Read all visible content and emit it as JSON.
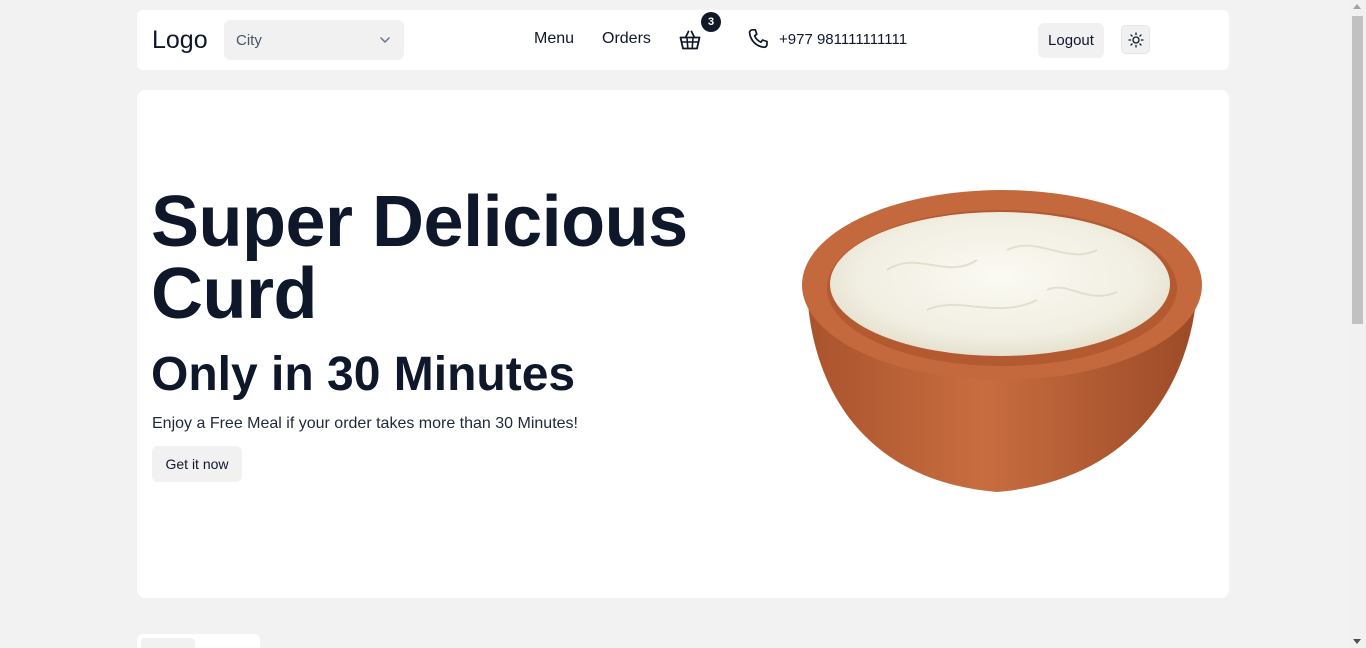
{
  "header": {
    "logo": "Logo",
    "city_select": {
      "value": "City"
    },
    "nav": {
      "menu": "Menu",
      "orders": "Orders"
    },
    "cart": {
      "count": "3",
      "icon": "basket-icon"
    },
    "phone": {
      "number": "+977 981111111111",
      "icon": "phone-icon"
    },
    "logout_label": "Logout",
    "theme_toggle_icon": "sun-icon"
  },
  "hero": {
    "title": "Super Delicious Curd",
    "subtitle": "Only in 30 Minutes",
    "description": "Enjoy a Free Meal if your order takes more than 30 Minutes!",
    "cta_label": "Get it now",
    "image": "curd-bowl"
  },
  "colors": {
    "page_background": "#f2f2f2",
    "card_background": "#ffffff",
    "text_primary": "#0f172a",
    "button_background": "#f1f1f1",
    "badge_background": "#111827",
    "clay": "#c0643a"
  }
}
